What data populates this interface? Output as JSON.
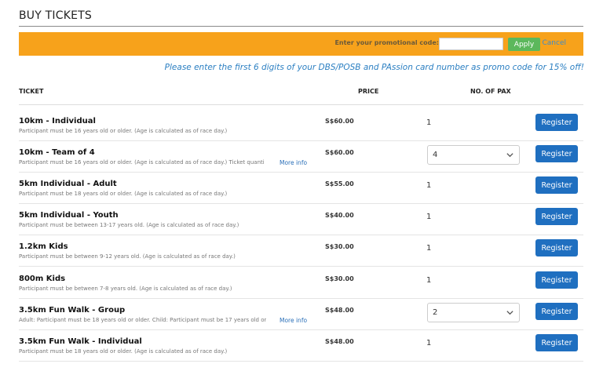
{
  "page": {
    "title": "BUY TICKETS"
  },
  "promo": {
    "label": "Enter your promotional code:",
    "input_value": "",
    "apply_label": "Apply",
    "cancel_label": "Cancel",
    "note": "Please enter the first 6 digits of your DBS/POSB and PAssion card number as promo code for 15% off!"
  },
  "table": {
    "headers": {
      "ticket": "TICKET",
      "price": "PRICE",
      "pax": "NO. OF PAX"
    },
    "more_info_label": "More info",
    "register_label": "Register",
    "rows": [
      {
        "name": "10km - Individual",
        "desc": "Participant must be 16 years old or older. (Age is calculated as of race day.)",
        "price": "S$60.00",
        "qty": "1",
        "select": false,
        "more_info": false
      },
      {
        "name": "10km - Team of 4",
        "desc": "Participant must be 16 years old or older. (Age is calculated as of race day.) Ticket quanti",
        "price": "S$60.00",
        "qty": "4",
        "select": true,
        "more_info": true
      },
      {
        "name": "5km Individual - Adult",
        "desc": "Participant must be 18 years old or older. (Age is calculated as of race day.)",
        "price": "S$55.00",
        "qty": "1",
        "select": false,
        "more_info": false
      },
      {
        "name": "5km Individual - Youth",
        "desc": "Participant must be between 13-17 years old. (Age is calculated as of race day.)",
        "price": "S$40.00",
        "qty": "1",
        "select": false,
        "more_info": false
      },
      {
        "name": "1.2km Kids",
        "desc": "Participant must be between 9-12 years old. (Age is calculated as of race day.)",
        "price": "S$30.00",
        "qty": "1",
        "select": false,
        "more_info": false
      },
      {
        "name": "800m Kids",
        "desc": "Participant must be between 7-8 years old. (Age is calculated as of race day.)",
        "price": "S$30.00",
        "qty": "1",
        "select": false,
        "more_info": false
      },
      {
        "name": "3.5km Fun Walk - Group",
        "desc": "Adult: Participant must be 18 years old or older. Child: Participant must be 17 years old or",
        "price": "S$48.00",
        "qty": "2",
        "select": true,
        "more_info": true
      },
      {
        "name": "3.5km Fun Walk - Individual",
        "desc": "Participant must be 18 years old or older. (Age is calculated as of race day.)",
        "price": "S$48.00",
        "qty": "1",
        "select": false,
        "more_info": false
      }
    ]
  },
  "colors": {
    "promo_bar": "#f7a21b",
    "apply": "#5cb85c",
    "register": "#1f6fc0",
    "note": "#2b7fc2"
  },
  "icons": {
    "select_arrow": "chevron-down-icon"
  }
}
